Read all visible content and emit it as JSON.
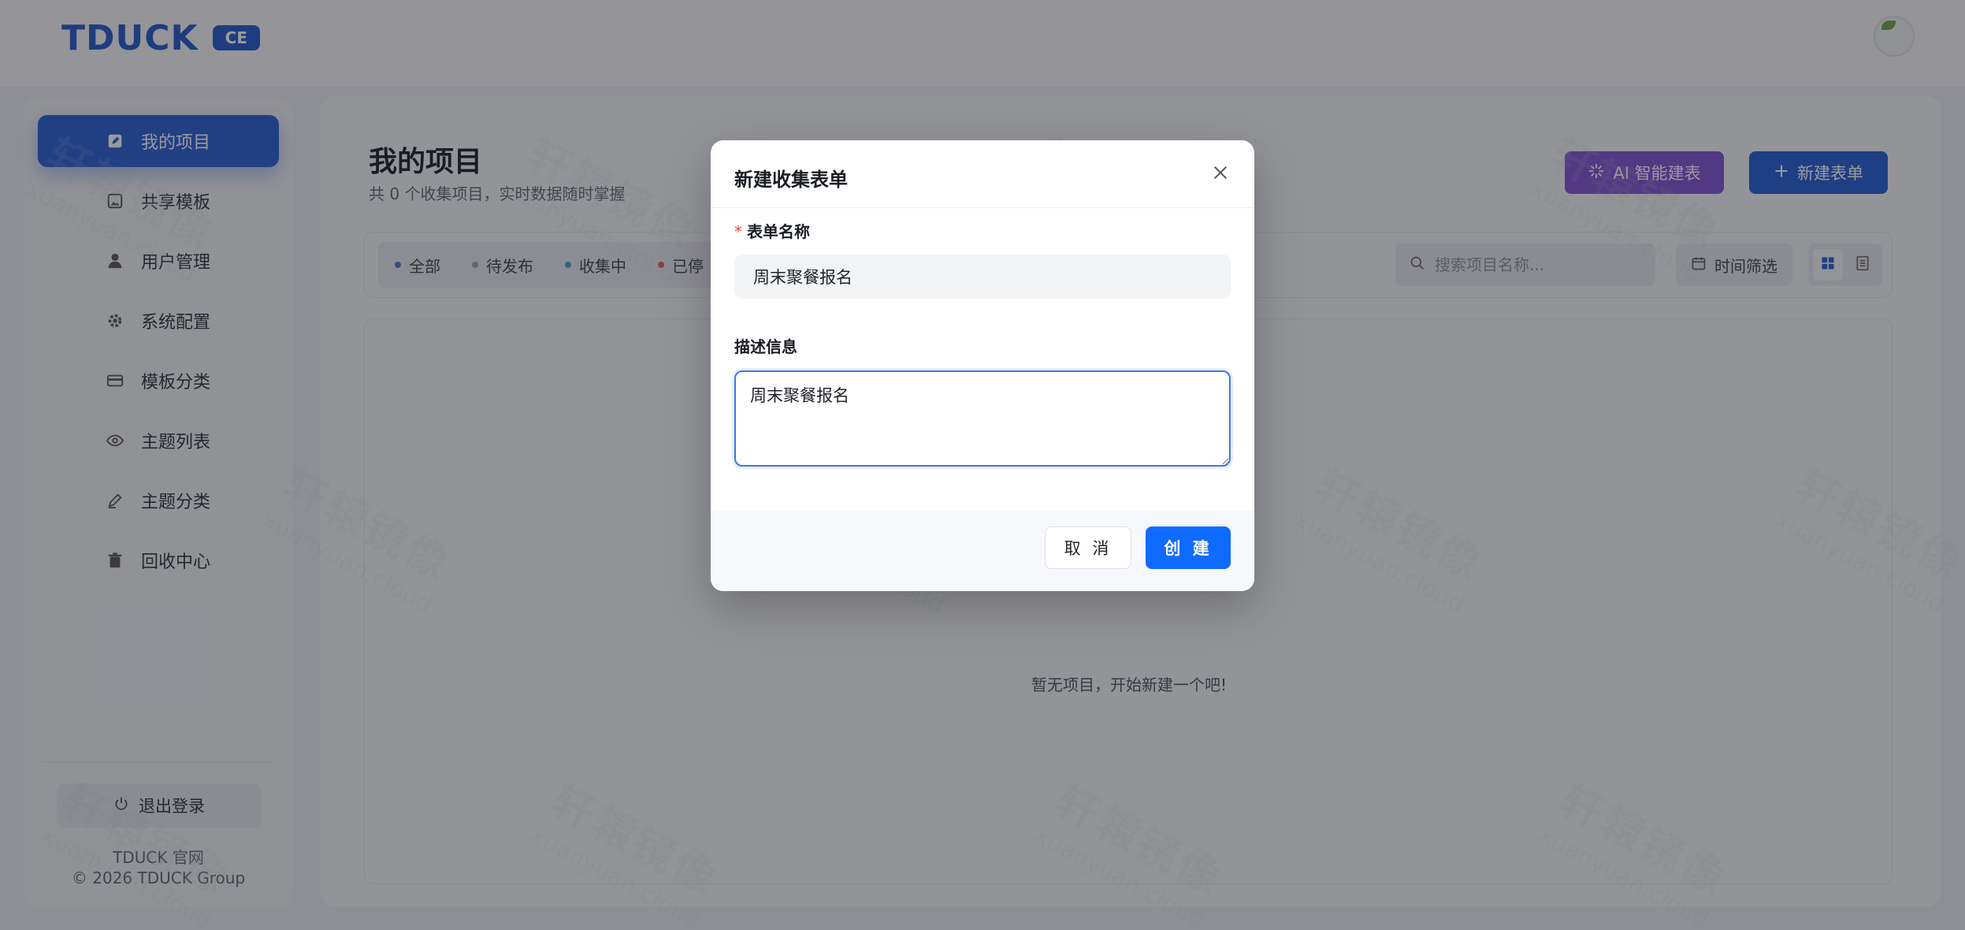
{
  "header": {
    "logo_text": "TDUCK",
    "logo_badge": "CE"
  },
  "sidebar": {
    "items": [
      {
        "label": "我的项目",
        "icon": "edit-icon",
        "active": true
      },
      {
        "label": "共享模板",
        "icon": "image-icon",
        "active": false
      },
      {
        "label": "用户管理",
        "icon": "user-icon",
        "active": false
      },
      {
        "label": "系统配置",
        "icon": "gear-icon",
        "active": false
      },
      {
        "label": "模板分类",
        "icon": "card-icon",
        "active": false
      },
      {
        "label": "主题列表",
        "icon": "eye-icon",
        "active": false
      },
      {
        "label": "主题分类",
        "icon": "pen-icon",
        "active": false
      },
      {
        "label": "回收中心",
        "icon": "trash-icon",
        "active": false
      }
    ],
    "logout_label": "退出登录",
    "site_link": "TDUCK 官网",
    "copyright": "© 2026 TDUCK Group"
  },
  "main": {
    "title": "我的项目",
    "subtitle": "共 0 个收集项目，实时数据随时掌握",
    "ai_button": "AI 智能建表",
    "new_button": "新建表单",
    "status_tabs": [
      {
        "label": "全部",
        "color": "#3a7bd5"
      },
      {
        "label": "待发布",
        "color": "#9aa0a8"
      },
      {
        "label": "收集中",
        "color": "#3a9bd5"
      },
      {
        "label": "已停",
        "color": "#e0564a"
      }
    ],
    "search_placeholder": "搜索项目名称...",
    "time_filter": "时间筛选",
    "empty_text": "暂无项目，开始新建一个吧!"
  },
  "watermark": {
    "cn": "轩辕镜像",
    "en": "xuanyuan.cloud"
  },
  "modal": {
    "title": "新建收集表单",
    "name_label": "表单名称",
    "name_required_mark": "*",
    "name_value": "周末聚餐报名",
    "desc_label": "描述信息",
    "desc_value": "周末聚餐报名",
    "cancel_label": "取 消",
    "create_label": "创 建"
  },
  "colors": {
    "primary": "#2459cf",
    "create_button": "#0f6bff",
    "ai_button": "#7b4fcf",
    "required": "#f04438"
  }
}
